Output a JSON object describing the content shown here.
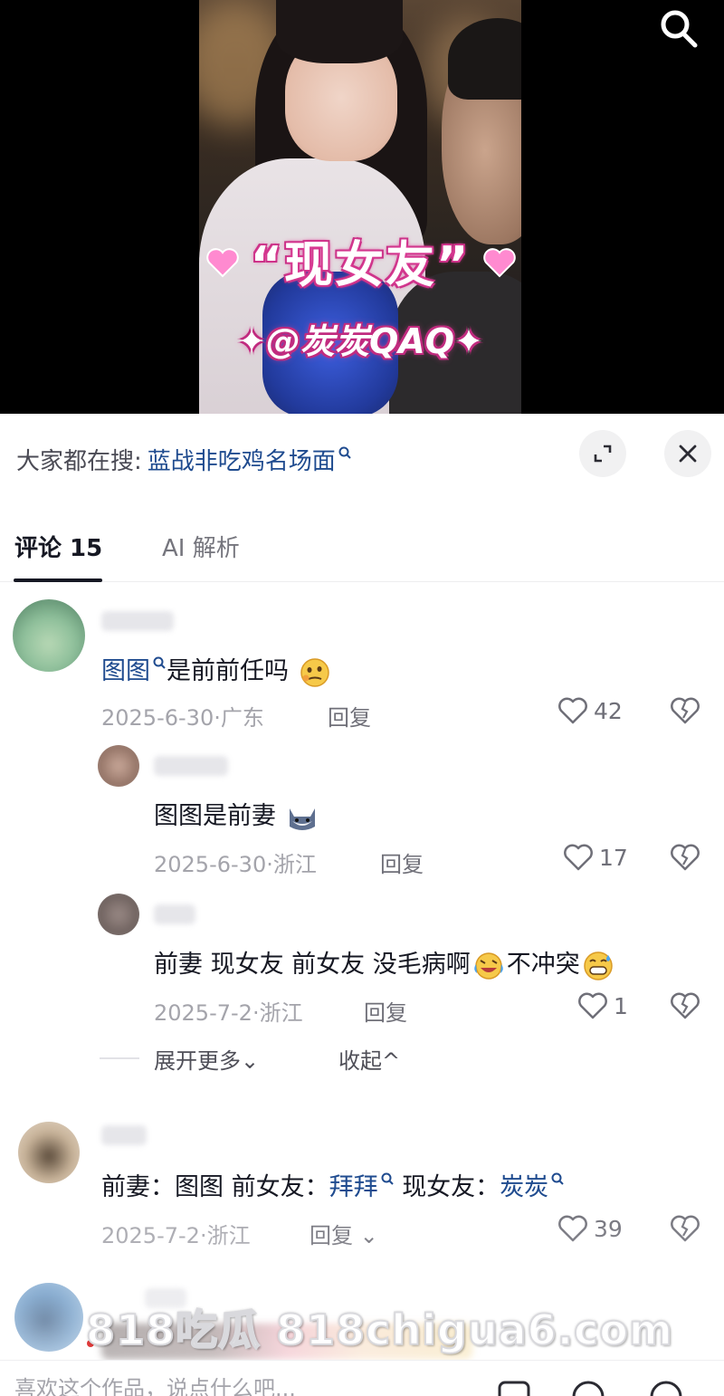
{
  "video": {
    "caption_main": "“现女友”",
    "caption_handle": "✦@炭炭QAQ✦"
  },
  "trending": {
    "prefix": "大家都在搜:",
    "link": "蓝战非吃鸡名场面"
  },
  "tabs": {
    "comments": "评论 15",
    "ai": "AI 解析"
  },
  "comments": [
    {
      "text_kw": "图图",
      "text_rest": "是前前任吗",
      "emoji": "thinking-face",
      "date_loc": "2025-6-30·广东",
      "reply": "回复",
      "likes": "42",
      "replies": [
        {
          "text": "图图是前妻",
          "emoji": "cat-face",
          "date_loc": "2025-6-30·浙江",
          "reply": "回复",
          "likes": "17"
        },
        {
          "text": "前妻 现女友 前女友 没毛病啊",
          "emoji1": "crying-laughing",
          "text2": "不冲突",
          "emoji2": "grinning-sweat",
          "date_loc": "2025-7-2·浙江",
          "reply": "回复",
          "likes": "1"
        }
      ],
      "expand_more": "展开更多⌄",
      "collapse": "收起^"
    },
    {
      "p1": "前妻：图图 前女友：",
      "kw1": "拜拜",
      "p2": "现女友：",
      "kw2": "炭炭",
      "date_loc": "2025-7-2·浙江",
      "reply": "回复 ⌄",
      "likes": "39"
    }
  ],
  "watermark": "818吃瓜 818chigua6.com",
  "input": {
    "placeholder": "喜欢这个作品，说点什么吧..."
  },
  "colors": {
    "keyword": "#1f4b8f",
    "meta": "#a4a4ab",
    "caption_glow": "#e0409a"
  }
}
